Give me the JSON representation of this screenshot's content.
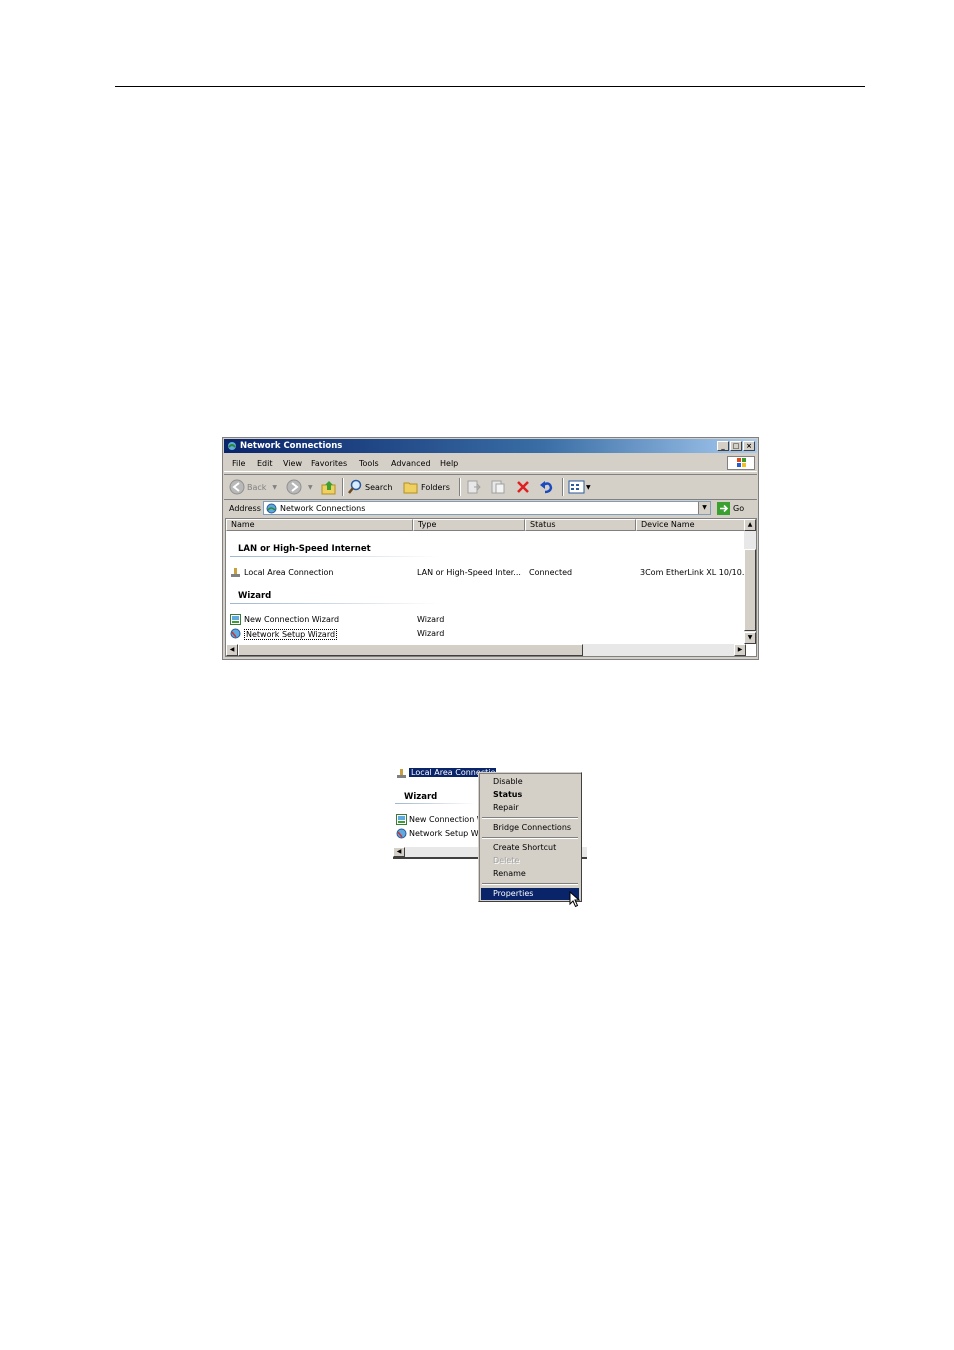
{
  "window": {
    "title": "Network Connections",
    "menu": [
      "File",
      "Edit",
      "View",
      "Favorites",
      "Tools",
      "Advanced",
      "Help"
    ],
    "toolbar": {
      "back": "Back",
      "search": "Search",
      "folders": "Folders"
    },
    "address": {
      "label": "Address",
      "value": "Network Connections",
      "go": "Go"
    },
    "columns": [
      "Name",
      "Type",
      "Status",
      "Device Name"
    ],
    "groups": [
      {
        "title": "LAN or High-Speed Internet",
        "rows": [
          {
            "name": "Local Area Connection",
            "type": "LAN or High-Speed Inter...",
            "status": "Connected",
            "device": "3Com EtherLink XL 10/10..."
          }
        ]
      },
      {
        "title": "Wizard",
        "rows": [
          {
            "name": "New Connection Wizard",
            "type": "Wizard"
          },
          {
            "name": "Network Setup Wizard",
            "type": "Wizard"
          }
        ]
      }
    ]
  },
  "context_view": {
    "selected_item": "Local Area Connection",
    "group_title": "Wizard",
    "items": [
      "New Connection W",
      "Network Setup Wi"
    ],
    "menu": [
      {
        "label": "Disable"
      },
      {
        "label": "Status",
        "style": "bold"
      },
      {
        "label": "Repair"
      },
      {
        "label": "Bridge Connections"
      },
      {
        "label": "Create Shortcut"
      },
      {
        "label": "Delete",
        "style": "disabled"
      },
      {
        "label": "Rename"
      },
      {
        "label": "Properties",
        "style": "highlighted"
      }
    ]
  },
  "colors": {
    "title_bar": "#0a246a",
    "highlight": "#0a246a",
    "face": "#d4d0c8"
  }
}
